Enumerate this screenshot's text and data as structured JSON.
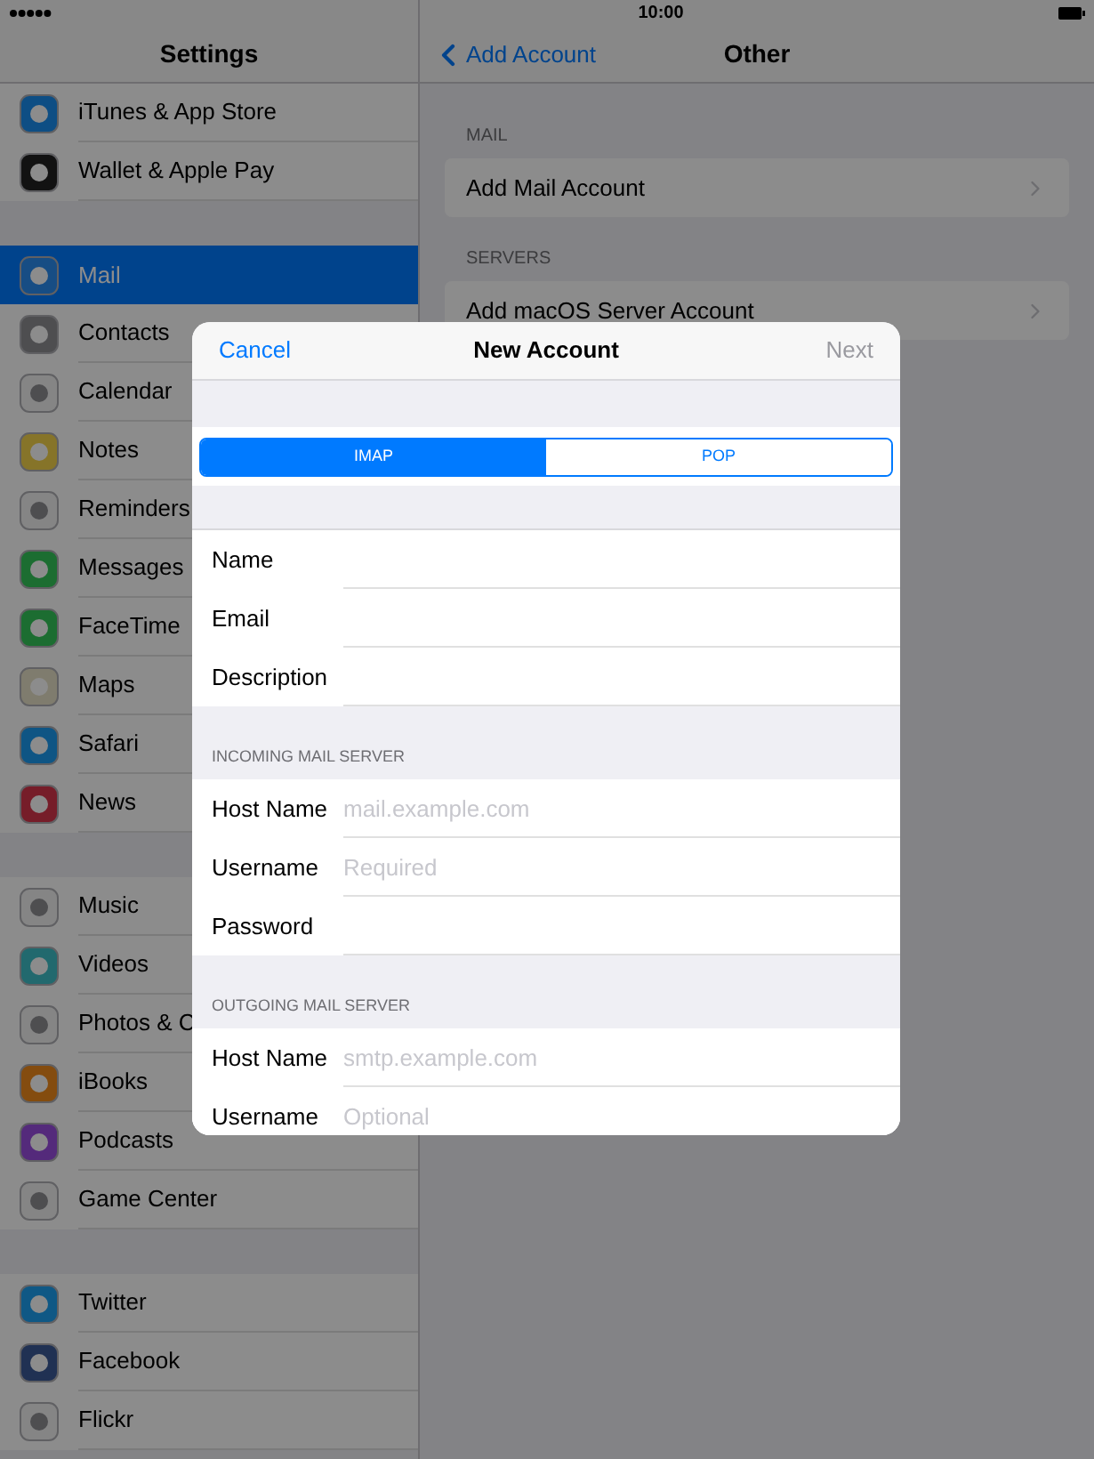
{
  "status_bar": {
    "time": "10:00"
  },
  "sidebar": {
    "title": "Settings",
    "groups": [
      [
        {
          "label": "iTunes & App Store",
          "selected": false
        },
        {
          "label": "Wallet & Apple Pay",
          "selected": false
        }
      ],
      [
        {
          "label": "Mail",
          "selected": true
        },
        {
          "label": "Contacts",
          "selected": false
        },
        {
          "label": "Calendar",
          "selected": false
        },
        {
          "label": "Notes",
          "selected": false
        },
        {
          "label": "Reminders",
          "selected": false
        },
        {
          "label": "Messages",
          "selected": false
        },
        {
          "label": "FaceTime",
          "selected": false
        },
        {
          "label": "Maps",
          "selected": false
        },
        {
          "label": "Safari",
          "selected": false
        },
        {
          "label": "News",
          "selected": false
        }
      ],
      [
        {
          "label": "Music",
          "selected": false
        },
        {
          "label": "Videos",
          "selected": false
        },
        {
          "label": "Photos & C",
          "selected": false
        },
        {
          "label": "iBooks",
          "selected": false
        },
        {
          "label": "Podcasts",
          "selected": false
        },
        {
          "label": "Game Center",
          "selected": false
        }
      ],
      [
        {
          "label": "Twitter",
          "selected": false
        },
        {
          "label": "Facebook",
          "selected": false
        },
        {
          "label": "Flickr",
          "selected": false
        }
      ]
    ]
  },
  "detail": {
    "back": "Add Account",
    "title": "Other",
    "sections": [
      {
        "header": "MAIL",
        "items": [
          "Add Mail Account"
        ]
      },
      {
        "header": "SERVERS",
        "items": [
          "Add macOS Server Account"
        ]
      }
    ]
  },
  "modal": {
    "cancel": "Cancel",
    "title": "New Account",
    "next": {
      "label": "Next",
      "disabled": true
    },
    "segments": [
      {
        "label": "IMAP",
        "selected": true
      },
      {
        "label": "POP",
        "selected": false
      }
    ],
    "groups": [
      {
        "fields": [
          {
            "label": "Name"
          },
          {
            "label": "Email"
          },
          {
            "label": "Description"
          }
        ]
      },
      {
        "header": "INCOMING MAIL SERVER",
        "fields": [
          {
            "label": "Host Name",
            "placeholder": "mail.example.com"
          },
          {
            "label": "Username",
            "placeholder": "Required"
          },
          {
            "label": "Password"
          }
        ]
      },
      {
        "header": "OUTGOING MAIL SERVER",
        "fields": [
          {
            "label": "Host Name",
            "placeholder": "smtp.example.com"
          },
          {
            "label": "Username",
            "placeholder": "Optional"
          }
        ]
      }
    ]
  }
}
